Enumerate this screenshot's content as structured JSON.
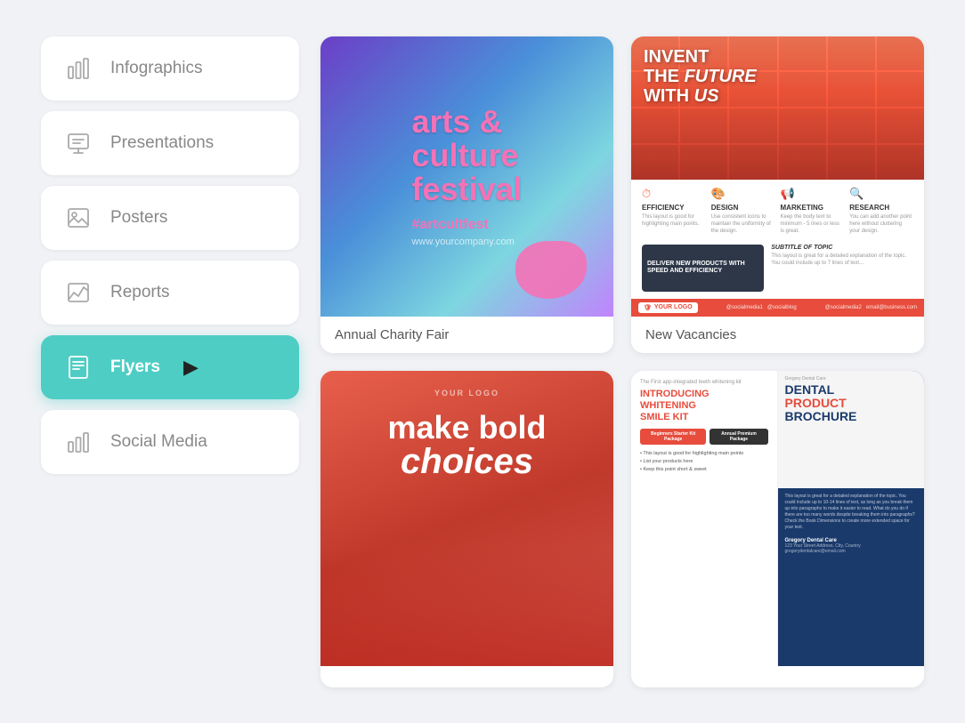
{
  "sidebar": {
    "items": [
      {
        "id": "infographics",
        "label": "Infographics",
        "icon": "bar-chart-icon",
        "active": false
      },
      {
        "id": "presentations",
        "label": "Presentations",
        "icon": "presentation-icon",
        "active": false
      },
      {
        "id": "posters",
        "label": "Posters",
        "icon": "image-icon",
        "active": false
      },
      {
        "id": "reports",
        "label": "Reports",
        "icon": "trend-icon",
        "active": false
      },
      {
        "id": "flyers",
        "label": "Flyers",
        "icon": "flyer-icon",
        "active": true
      },
      {
        "id": "social-media",
        "label": "Social Media",
        "icon": "chart-icon",
        "active": false
      }
    ]
  },
  "cards": [
    {
      "id": "arts-festival",
      "title": "arts &\nculture\nfestival",
      "hashtag": "#artcultfest",
      "website": "www.yourcompany.com",
      "label": "Annual Charity Fair"
    },
    {
      "id": "invent-future",
      "title": "INVENT\nTHE FUTURE\nWITH US",
      "subtitle": "SUBTITLE OF TOPIC",
      "label": "New Vacancies",
      "features": [
        {
          "name": "EFFICIENCY",
          "desc": "This layout is good for highlighting main points."
        },
        {
          "name": "DESIGN",
          "desc": "Use consistent icons to maintain the uniformity of the design."
        },
        {
          "name": "MARKETING",
          "desc": "Keep the body text to minimum - 5 lines or less is great."
        },
        {
          "name": "RESEARCH",
          "desc": "You can add another point here without cluttering your design."
        }
      ],
      "deliver_text": "DELIVER NEW PRODUCTS WITH SPEED AND EFFICIENCY",
      "logo": "YOUR LOGO"
    },
    {
      "id": "bold-choices",
      "logo": "YOUR LOGO",
      "main_text": "make bold",
      "italic_text": "choices",
      "label": ""
    },
    {
      "id": "dental",
      "whitening_tag": "The First app-integrated teeth whitening kit",
      "whitening_title": "INTRODUCING\nWHITENING\nSMILE KIT",
      "packages": [
        {
          "name": "Beginners Starter Kit Package"
        },
        {
          "name": "Annual Premium Package"
        }
      ],
      "brochure_title": "DENTAL\nPRODUCT\nBROCHURE",
      "label": ""
    }
  ]
}
